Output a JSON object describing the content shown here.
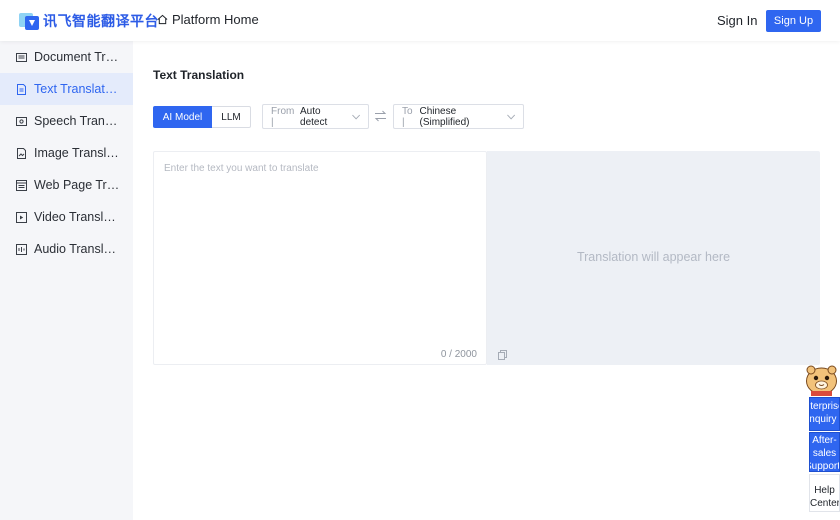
{
  "header": {
    "logo_text": "讯飞智能翻译平台",
    "home_label": "Platform Home",
    "signin_label": "Sign In",
    "signup_label": "Sign Up"
  },
  "sidebar": {
    "items": [
      {
        "label": "Document Translation",
        "icon": "document-icon",
        "active": false
      },
      {
        "label": "Text Translation",
        "icon": "text-file-icon",
        "active": true
      },
      {
        "label": "Speech Translation",
        "icon": "speech-icon",
        "active": false
      },
      {
        "label": "Image Translation",
        "icon": "image-icon",
        "active": false
      },
      {
        "label": "Web Page Translation",
        "icon": "web-page-icon",
        "active": false
      },
      {
        "label": "Video Translation",
        "icon": "video-icon",
        "active": false
      },
      {
        "label": "Audio Translation",
        "icon": "audio-icon",
        "active": false
      }
    ]
  },
  "main": {
    "title": "Text Translation",
    "modes": [
      "AI Model",
      "LLM"
    ],
    "active_mode": "AI Model",
    "from_prefix": "From |",
    "from_value": "Auto detect",
    "to_prefix": "To |",
    "to_value": "Chinese (Simplified)",
    "input_placeholder": "Enter the text you want to translate",
    "input_value": "",
    "counter": "0 / 2000",
    "output_placeholder": "Translation will appear here"
  },
  "floating": {
    "enterprise": [
      "Enterprise",
      "Inquiry"
    ],
    "after_sales": [
      "After-",
      "sales",
      "Support"
    ],
    "help": [
      "Help",
      "Center"
    ]
  },
  "colors": {
    "accent": "#2f66f0",
    "sidebar_bg": "#f5f6f9",
    "sidebar_active_bg": "#e4ebfb",
    "output_bg": "#edf0f5"
  }
}
